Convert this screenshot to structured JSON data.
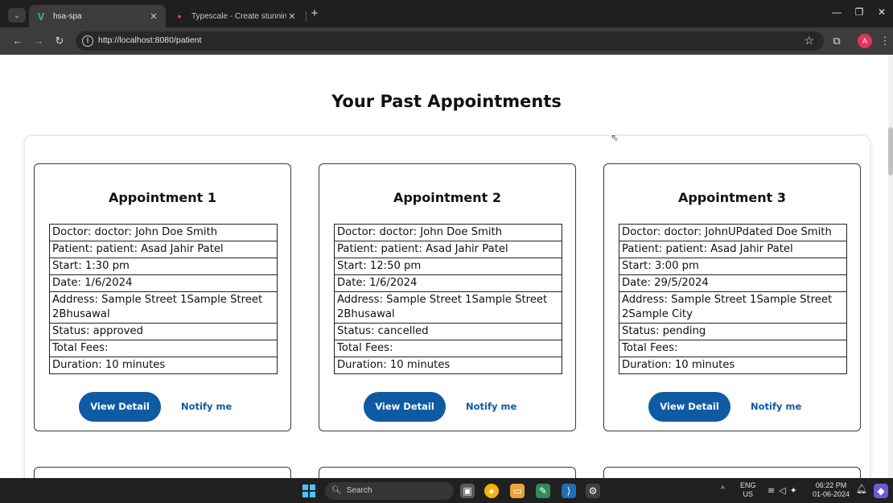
{
  "browser": {
    "tabs": [
      {
        "favicon": "V",
        "title": "hsa-spa",
        "active": true
      },
      {
        "favicon": "•",
        "title": "Typescale - Create stunning typ",
        "active": false
      }
    ],
    "url": "http://localhost:8080/patient",
    "profile_initial": "A"
  },
  "page": {
    "title": "Your Past Appointments",
    "appointments": [
      {
        "title": "Appointment 1",
        "rows": [
          "Doctor: doctor: John Doe Smith",
          "Patient: patient: Asad Jahir Patel",
          "Start: 1:30 pm",
          "Date: 1/6/2024",
          "Address: Sample Street 1Sample Street 2Bhusawal",
          "Status: approved",
          "Total Fees:",
          "Duration: 10 minutes"
        ],
        "view_label": "View Detail",
        "notify_label": "Notify me"
      },
      {
        "title": "Appointment 2",
        "rows": [
          "Doctor: doctor: John Doe Smith",
          "Patient: patient: Asad Jahir Patel",
          "Start: 12:50 pm",
          "Date: 1/6/2024",
          "Address: Sample Street 1Sample Street 2Bhusawal",
          "Status: cancelled",
          "Total Fees:",
          "Duration: 10 minutes"
        ],
        "view_label": "View Detail",
        "notify_label": "Notify me"
      },
      {
        "title": "Appointment 3",
        "rows": [
          "Doctor: doctor: JohnUPdated Doe Smith",
          "Patient: patient: Asad Jahir Patel",
          "Start: 3:00 pm",
          "Date: 29/5/2024",
          "Address: Sample Street 1Sample Street 2Sample City",
          "Status: pending",
          "Total Fees:",
          "Duration: 10 minutes"
        ],
        "view_label": "View Detail",
        "notify_label": "Notify me"
      }
    ]
  },
  "taskbar": {
    "search_placeholder": "Search",
    "lang_top": "ENG",
    "lang_bottom": "US",
    "time": "06:22 PM",
    "date": "01-06-2024"
  },
  "colors": {
    "accent": "#0e5ba3",
    "chrome_dark": "#1f1f1f",
    "chrome_toolbar": "#3c3c3c"
  }
}
